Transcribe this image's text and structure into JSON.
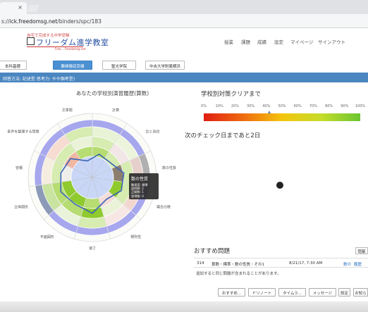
{
  "browser": {
    "tab_close": "×",
    "url_prefix": "s://",
    "url_host": "ick.freedomsg.net",
    "url_path": "/binders/spc/183"
  },
  "brand": {
    "tagline": "自宅で完成する中学受験",
    "name": "フリーダム進学教室",
    "sub": "Free... Freedomsg.net"
  },
  "nav": [
    "授業",
    "課題",
    "成績",
    "設定",
    "マイページ",
    "サインアウト"
  ],
  "controls": [
    "本科基礎",
    "難関徹底受講",
    "聖光学院",
    "中央大学附属横浜"
  ],
  "info_bar": "回答方法: 記述型 思考力: やや個考型)",
  "radar": {
    "title": "あなたの学校別演習履歴(算数)",
    "labels": [
      "計算",
      "比と割合",
      "数の性質",
      "場合の数",
      "規則性",
      "速さ",
      "平面図形",
      "立体図形",
      "容積",
      "条件を整理する問題",
      "文章題"
    ],
    "colors": {
      "outer_ring": "#a7a7ee",
      "green_light": "#d6ecb0",
      "green_mid": "#b6dc72",
      "green_dark": "#8fca2f",
      "blue_line": "#3a63b5",
      "inner_fill": "#c9d6f5"
    },
    "values": [
      0.42,
      0.4,
      0.55,
      0.55,
      0.45,
      0.62,
      0.55,
      0.6,
      0.55,
      0.5,
      0.3
    ]
  },
  "tooltip": {
    "title": "数の性質",
    "lines": [
      "難易度: 標準",
      "設問数: 2",
      "正解数: 1",
      "習得数: 0"
    ]
  },
  "goal": {
    "title": "学校別対策クリアまで",
    "ticks": [
      "0%",
      "10%",
      "20%",
      "30%",
      "40%",
      "50%",
      "60%",
      "70%",
      "80%",
      "90%",
      "100%"
    ],
    "progress_percent": 42
  },
  "next_check": {
    "title": "次のチェック日まであと2日"
  },
  "recommend": {
    "title": "おすすめ問題",
    "hide_label": "隠蔽",
    "row": {
      "num": "314",
      "name": "算数・標準・数の性質・その1",
      "date": "8/21/17, 7:30 AM",
      "link1": "数の",
      "link2": "履歴"
    },
    "note": "追加すると同じ問題が含まれることがあります。"
  },
  "bottom_buttons": [
    "おすすめ...",
    "ドリノート",
    "タイムラ...",
    "メッセージ",
    "設定",
    "お知ら"
  ]
}
